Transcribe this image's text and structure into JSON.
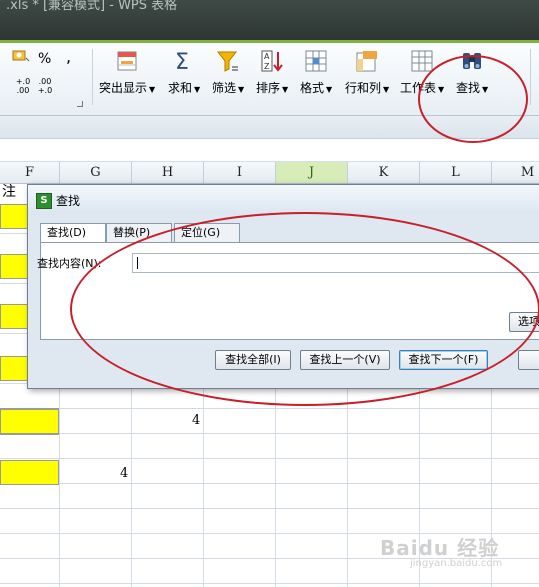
{
  "window": {
    "title": ".xls * [兼容模式] - WPS 表格"
  },
  "ribbon": {
    "percent_symbol": "%",
    "comma_symbol": ",",
    "decimal_increase": "+.0 .00",
    "decimal_decrease": ".00 +.0",
    "buttons": [
      {
        "label": "突出显示",
        "icon": "highlight-icon"
      },
      {
        "label": "求和",
        "icon": "sum-icon"
      },
      {
        "label": "筛选",
        "icon": "filter-icon"
      },
      {
        "label": "排序",
        "icon": "sort-icon"
      },
      {
        "label": "格式",
        "icon": "format-icon"
      },
      {
        "label": "行和列",
        "icon": "row-col-icon"
      },
      {
        "label": "工作表",
        "icon": "worksheet-icon"
      },
      {
        "label": "查找",
        "icon": "binoculars-icon"
      }
    ]
  },
  "sheet": {
    "columns": [
      "F",
      "G",
      "H",
      "I",
      "J",
      "K",
      "L",
      "M"
    ],
    "selected_column": "J",
    "partial_cell_text": "注",
    "cell_values": [
      {
        "label": "h-value",
        "text": "4"
      },
      {
        "label": "g-value",
        "text": "4"
      }
    ]
  },
  "dialog": {
    "title": "查找",
    "tabs": [
      "查找(D)",
      "替换(P)",
      "定位(G)"
    ],
    "active_tab": 0,
    "find_label": "查找内容(N):",
    "find_value": "",
    "options_button": "选项",
    "buttons": {
      "find_all": "查找全部(I)",
      "find_prev": "查找上一个(V)",
      "find_next": "查找下一个(F)"
    }
  },
  "watermark": {
    "text": "Baidu 经验",
    "sub": "jingyan.baidu.com"
  },
  "colors": {
    "accent_green": "#7fb13c",
    "highlight_yellow": "#ffff00",
    "annotation_red": "#c8202a"
  }
}
